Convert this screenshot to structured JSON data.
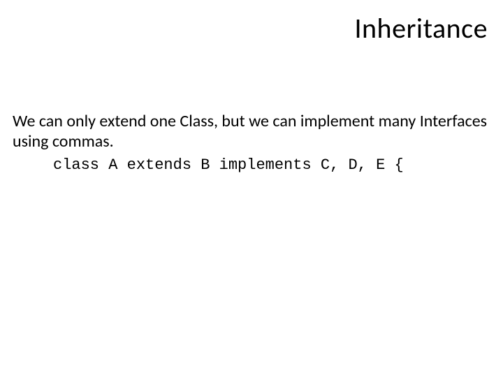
{
  "title": "Inheritance",
  "paragraph": "We can only extend one Class, but we can implement many Interfaces using commas.",
  "code": "class A extends B implements C, D, E {"
}
